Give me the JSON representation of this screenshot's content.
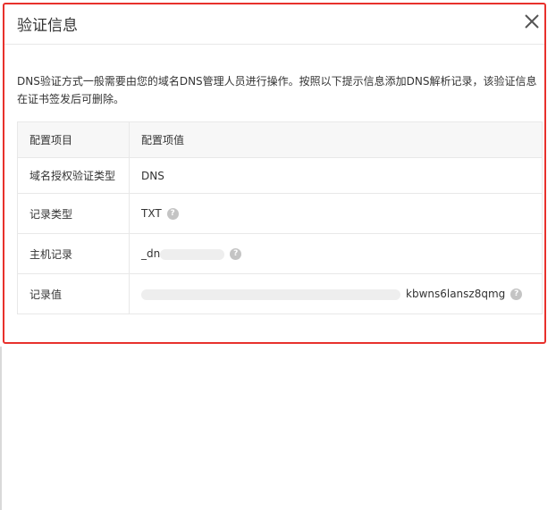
{
  "dialog": {
    "title": "验证信息",
    "description": "DNS验证方式一般需要由您的域名DNS管理人员进行操作。按照以下提示信息添加DNS解析记录，该验证信息在证书签发后可删除。"
  },
  "table": {
    "headers": [
      "配置项目",
      "配置项值"
    ],
    "rows": [
      {
        "key": "域名授权验证类型",
        "value": "DNS",
        "help": false
      },
      {
        "key": "记录类型",
        "value": "TXT",
        "help": true
      },
      {
        "key": "主机记录",
        "value": "_dn",
        "help": true
      },
      {
        "key": "记录值",
        "value": "kbwns6lansz8qmg",
        "help": true
      }
    ]
  },
  "colors": {
    "highlight_border": "#e8312c",
    "help_icon": "#c4c4c4"
  }
}
